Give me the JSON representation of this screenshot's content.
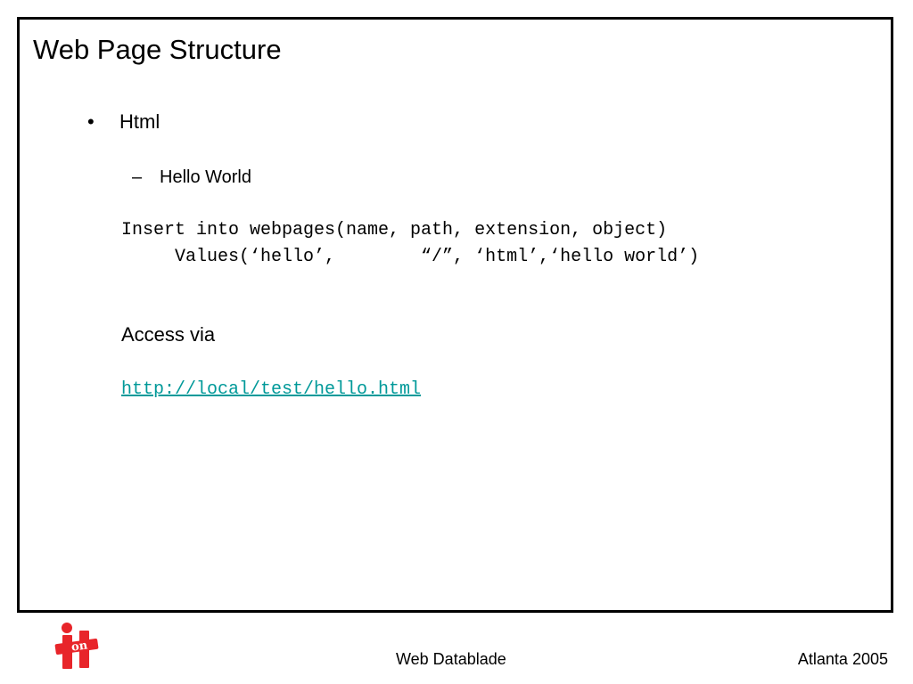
{
  "slide": {
    "title": "Web Page Structure",
    "bullet": {
      "marker": "•",
      "label": "Html"
    },
    "sub_bullet": {
      "marker": "–",
      "label": "Hello World"
    },
    "code": [
      "Insert into webpages(name, path, extension, object)",
      "     Values(‘hello’,        “/”, ‘html’,‘hello world’)"
    ],
    "access_label": "Access via",
    "link": {
      "text": "http://local/test/hello.html",
      "color": "#009999"
    }
  },
  "footer": {
    "center": "Web Datablade",
    "right": "Atlanta 2005",
    "logo": {
      "icon": "on-it-logo",
      "text_top": "on",
      "text_main": "it",
      "color": "#e8252a"
    }
  },
  "colors": {
    "frame": "#000000",
    "text": "#000000",
    "link": "#009999",
    "logo": "#e8252a"
  }
}
